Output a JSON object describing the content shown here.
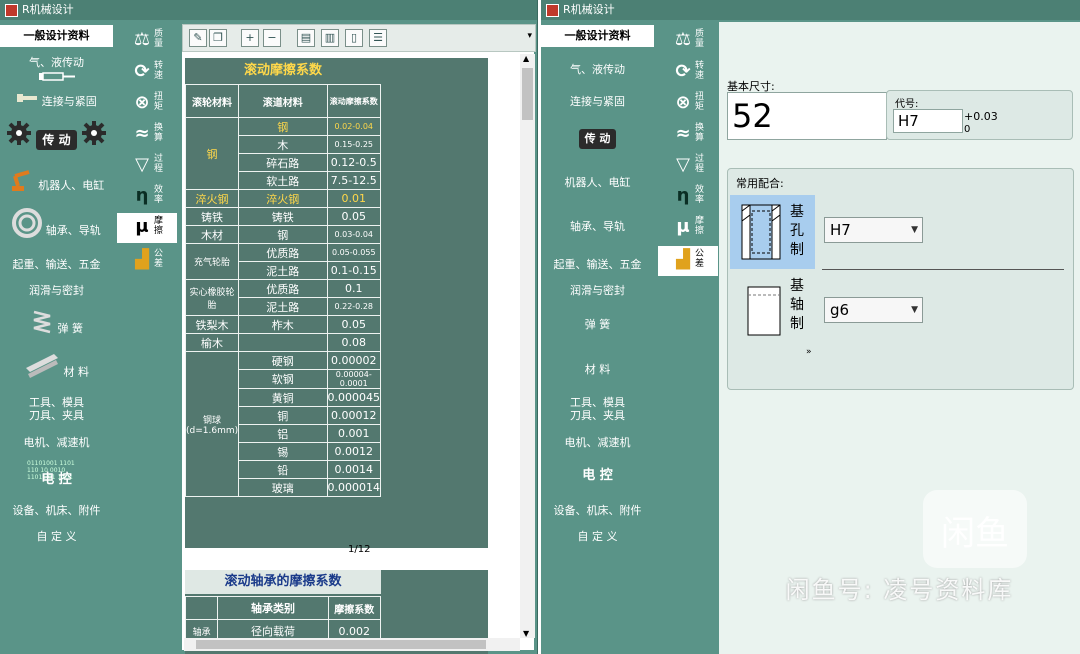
{
  "app": {
    "title": "R机械设计"
  },
  "categories": [
    {
      "label": "一般设计资料",
      "icon": "none"
    },
    {
      "label": "气、液传动",
      "icon": "cylinder-icon"
    },
    {
      "label": "连接与紧固",
      "icon": "bolt-icon"
    },
    {
      "label": "传 动",
      "icon": "gear-icon"
    },
    {
      "label": "机器人、电缸",
      "icon": "robot-arm-icon"
    },
    {
      "label": "轴承、导轨",
      "icon": "bearing-icon"
    },
    {
      "label": "起重、输送、五金",
      "icon": "none"
    },
    {
      "label": "润滑与密封",
      "icon": "none"
    },
    {
      "label": "弹 簧",
      "icon": "spring-icon"
    },
    {
      "label": "材 料",
      "icon": "i-beam-icon"
    },
    {
      "label": "工具、模具\n刀具、夹具",
      "icon": "none"
    },
    {
      "label": "电机、减速机",
      "icon": "none"
    },
    {
      "label": "电 控",
      "icon": "binary-icon",
      "deco": "01101001 1101\n110 10 0010\n11011 01 1101"
    },
    {
      "label": "设备、机床、附件",
      "icon": "none"
    },
    {
      "label": "自 定 义",
      "icon": "none"
    }
  ],
  "subcats": [
    {
      "label": "质量",
      "glyph": "⚖"
    },
    {
      "label": "转速",
      "glyph": "⟳"
    },
    {
      "label": "扭矩",
      "glyph": "⊗"
    },
    {
      "label": "换算",
      "glyph": "≈"
    },
    {
      "label": "过程",
      "glyph": "▽"
    },
    {
      "label": "效率",
      "glyph": "η"
    },
    {
      "label": "摩擦",
      "glyph": "μ"
    },
    {
      "label": "公差",
      "glyph": "▟"
    }
  ],
  "table1": {
    "title": "滚动摩擦系数",
    "headers": [
      "滚轮材料",
      "滚道材料",
      "滚动摩擦系数"
    ],
    "groups": [
      {
        "mat": "钢",
        "rows": [
          [
            "钢",
            "0.02-0.04"
          ],
          [
            "木",
            "0.15-0.25"
          ],
          [
            "碎石路",
            "0.12-0.5"
          ],
          [
            "软土路",
            "7.5-12.5"
          ]
        ]
      },
      {
        "mat": "淬火钢",
        "rows": [
          [
            "淬火钢",
            "0.01"
          ]
        ]
      },
      {
        "mat": "铸铁",
        "rows": [
          [
            "铸铁",
            "0.05"
          ]
        ]
      },
      {
        "mat": "木材",
        "rows": [
          [
            "钢",
            "0.03-0.04"
          ]
        ]
      },
      {
        "mat": "充气轮胎",
        "rows": [
          [
            "优质路",
            "0.05-0.055"
          ],
          [
            "泥土路",
            "0.1-0.15"
          ]
        ]
      },
      {
        "mat": "实心橡胶轮胎",
        "rows": [
          [
            "优质路",
            "0.1"
          ],
          [
            "泥土路",
            "0.22-0.28"
          ]
        ]
      },
      {
        "mat": "铁梨木",
        "rows": [
          [
            "柞木",
            "0.05"
          ]
        ]
      },
      {
        "mat": "榆木",
        "rows": [
          [
            "",
            "0.08"
          ]
        ]
      },
      {
        "mat": "钢球(d=1.6mm)",
        "rows": [
          [
            "硬钢",
            "0.00002"
          ],
          [
            "软钢",
            "0.00004-0.0001"
          ],
          [
            "黄铜",
            "0.000045"
          ],
          [
            "铜",
            "0.00012"
          ],
          [
            "铝",
            "0.001"
          ],
          [
            "锡",
            "0.0012"
          ],
          [
            "铅",
            "0.0014"
          ],
          [
            "玻璃",
            "0.000014"
          ]
        ]
      }
    ],
    "page": "1/12"
  },
  "table2": {
    "title": "滚动轴承的摩擦系数",
    "headers": [
      "轴承类别",
      "摩擦系数"
    ],
    "partial_row": [
      "径向载荷",
      "0.002"
    ],
    "partial_left": "轴承"
  },
  "tolerance": {
    "basic_size_label": "基本尺寸:",
    "basic_size_value": "52",
    "code_label": "代号:",
    "code_value": "H7",
    "upper_dev": "+0.03",
    "lower_dev": "0",
    "common_fits_label": "常用配合:",
    "hole_basis_label": "基\n孔\n制",
    "shaft_basis_label": "基\n轴\n制",
    "hole_fit": "H7",
    "shaft_fit": "g6",
    "more": "»"
  },
  "watermark": {
    "line1": "闲鱼",
    "line2": "闲鱼号: 凌号资料库"
  },
  "colors": {
    "sidebar": "#5a9488",
    "highlight": "#ffd84a",
    "table": "#53786f"
  }
}
